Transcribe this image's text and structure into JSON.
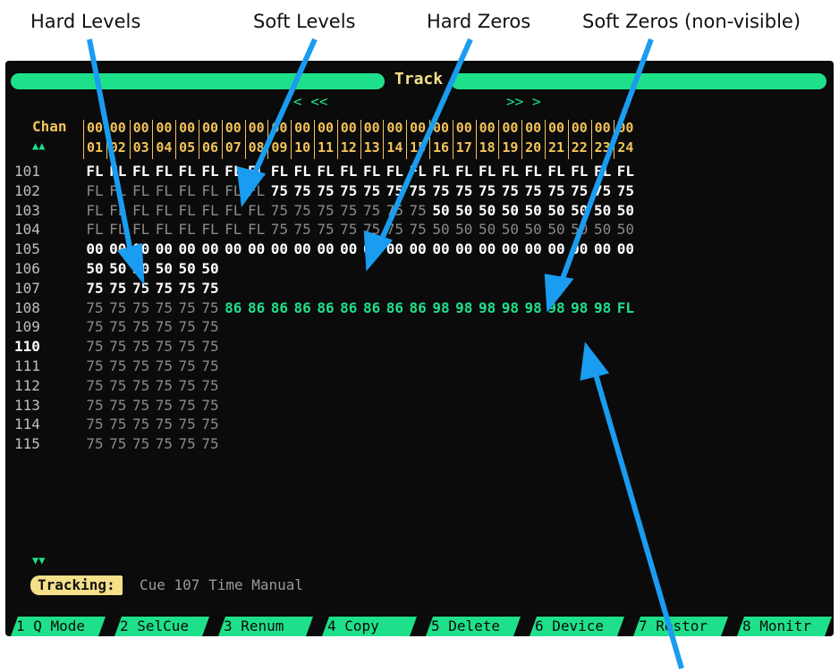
{
  "annotations": {
    "hard_levels": "Hard Levels",
    "soft_levels": "Soft Levels",
    "hard_zeros": "Hard Zeros",
    "soft_zeros": "Soft Zeros (non-visible)"
  },
  "screen": {
    "title": "Track",
    "nav_left": "< <<",
    "nav_right": ">> >",
    "chan_label": "Chan",
    "up_arrows": "▲▲",
    "down_arrows": "▼▼",
    "channel_hundreds": [
      "00",
      "00",
      "00",
      "00",
      "00",
      "00",
      "00",
      "00",
      "00",
      "00",
      "00",
      "00",
      "00",
      "00",
      "00",
      "00",
      "00",
      "00",
      "00",
      "00",
      "00",
      "00",
      "00",
      "00"
    ],
    "channel_units": [
      "01",
      "02",
      "03",
      "04",
      "05",
      "06",
      "07",
      "08",
      "09",
      "10",
      "11",
      "12",
      "13",
      "14",
      "15",
      "16",
      "17",
      "18",
      "19",
      "20",
      "21",
      "22",
      "23",
      "24"
    ],
    "cues": [
      {
        "num": "101",
        "cells": [
          "FL",
          "FL",
          "FL",
          "FL",
          "FL",
          "FL",
          "FL",
          "FL",
          "FL",
          "FL",
          "FL",
          "FL",
          "FL",
          "FL",
          "FL",
          "FL",
          "FL",
          "FL",
          "FL",
          "FL",
          "FL",
          "FL",
          "FL",
          "FL"
        ],
        "style": [
          "h",
          "h",
          "h",
          "h",
          "h",
          "h",
          "h",
          "h",
          "h",
          "h",
          "h",
          "h",
          "h",
          "h",
          "h",
          "h",
          "h",
          "h",
          "h",
          "h",
          "h",
          "h",
          "h",
          "h"
        ]
      },
      {
        "num": "102",
        "cells": [
          "FL",
          "FL",
          "FL",
          "FL",
          "FL",
          "FL",
          "FL",
          "FL",
          "75",
          "75",
          "75",
          "75",
          "75",
          "75",
          "75",
          "75",
          "75",
          "75",
          "75",
          "75",
          "75",
          "75",
          "75",
          "75"
        ],
        "style": [
          "s",
          "s",
          "s",
          "s",
          "s",
          "s",
          "s",
          "s",
          "h",
          "h",
          "h",
          "h",
          "h",
          "h",
          "h",
          "h",
          "h",
          "h",
          "h",
          "h",
          "h",
          "h",
          "h",
          "h"
        ]
      },
      {
        "num": "103",
        "cells": [
          "FL",
          "FL",
          "FL",
          "FL",
          "FL",
          "FL",
          "FL",
          "FL",
          "75",
          "75",
          "75",
          "75",
          "75",
          "75",
          "75",
          "50",
          "50",
          "50",
          "50",
          "50",
          "50",
          "50",
          "50",
          "50"
        ],
        "style": [
          "s",
          "s",
          "s",
          "s",
          "s",
          "s",
          "s",
          "s",
          "s",
          "s",
          "s",
          "s",
          "s",
          "s",
          "s",
          "h",
          "h",
          "h",
          "h",
          "h",
          "h",
          "h",
          "h",
          "h"
        ]
      },
      {
        "num": "104",
        "cells": [
          "FL",
          "FL",
          "FL",
          "FL",
          "FL",
          "FL",
          "FL",
          "FL",
          "75",
          "75",
          "75",
          "75",
          "75",
          "75",
          "75",
          "50",
          "50",
          "50",
          "50",
          "50",
          "50",
          "50",
          "50",
          "50"
        ],
        "style": [
          "s",
          "s",
          "s",
          "s",
          "s",
          "s",
          "s",
          "s",
          "s",
          "s",
          "s",
          "s",
          "s",
          "s",
          "s",
          "s",
          "s",
          "s",
          "s",
          "s",
          "s",
          "s",
          "s",
          "s"
        ]
      },
      {
        "num": "105",
        "cells": [
          "00",
          "00",
          "00",
          "00",
          "00",
          "00",
          "00",
          "00",
          "00",
          "00",
          "00",
          "00",
          "00",
          "00",
          "00",
          "00",
          "00",
          "00",
          "00",
          "00",
          "00",
          "00",
          "00",
          "00"
        ],
        "style": [
          "h",
          "h",
          "h",
          "h",
          "h",
          "h",
          "h",
          "h",
          "h",
          "h",
          "h",
          "h",
          "h",
          "h",
          "h",
          "h",
          "h",
          "h",
          "h",
          "h",
          "h",
          "h",
          "h",
          "h"
        ]
      },
      {
        "num": "106",
        "cells": [
          "50",
          "50",
          "50",
          "50",
          "50",
          "50"
        ],
        "style": [
          "h",
          "h",
          "h",
          "h",
          "h",
          "h"
        ]
      },
      {
        "num": "107",
        "cells": [
          "75",
          "75",
          "75",
          "75",
          "75",
          "75"
        ],
        "style": [
          "h",
          "h",
          "h",
          "h",
          "h",
          "h"
        ]
      },
      {
        "num": "108",
        "cells": [
          "75",
          "75",
          "75",
          "75",
          "75",
          "75",
          "86",
          "86",
          "86",
          "86",
          "86",
          "86",
          "86",
          "86",
          "86",
          "98",
          "98",
          "98",
          "98",
          "98",
          "98",
          "98",
          "98",
          "FL"
        ],
        "style": [
          "s",
          "s",
          "s",
          "s",
          "s",
          "s",
          "g",
          "g",
          "g",
          "g",
          "g",
          "g",
          "g",
          "g",
          "g",
          "g",
          "g",
          "g",
          "g",
          "g",
          "g",
          "g",
          "g",
          "g"
        ]
      },
      {
        "num": "109",
        "cells": [
          "75",
          "75",
          "75",
          "75",
          "75",
          "75"
        ],
        "style": [
          "s",
          "s",
          "s",
          "s",
          "s",
          "s"
        ]
      },
      {
        "num": "110",
        "cells": [
          "75",
          "75",
          "75",
          "75",
          "75",
          "75"
        ],
        "style": [
          "s",
          "s",
          "s",
          "s",
          "s",
          "s"
        ],
        "current": true
      },
      {
        "num": "111",
        "cells": [
          "75",
          "75",
          "75",
          "75",
          "75",
          "75"
        ],
        "style": [
          "s",
          "s",
          "s",
          "s",
          "s",
          "s"
        ]
      },
      {
        "num": "112",
        "cells": [
          "75",
          "75",
          "75",
          "75",
          "75",
          "75"
        ],
        "style": [
          "s",
          "s",
          "s",
          "s",
          "s",
          "s"
        ]
      },
      {
        "num": "113",
        "cells": [
          "75",
          "75",
          "75",
          "75",
          "75",
          "75"
        ],
        "style": [
          "s",
          "s",
          "s",
          "s",
          "s",
          "s"
        ]
      },
      {
        "num": "114",
        "cells": [
          "75",
          "75",
          "75",
          "75",
          "75",
          "75"
        ],
        "style": [
          "s",
          "s",
          "s",
          "s",
          "s",
          "s"
        ]
      },
      {
        "num": "115",
        "cells": [
          "75",
          "75",
          "75",
          "75",
          "75",
          "75"
        ],
        "style": [
          "s",
          "s",
          "s",
          "s",
          "s",
          "s"
        ]
      }
    ],
    "tracking_label": "Tracking:",
    "tracking_text": "Cue 107 Time Manual",
    "softkeys": [
      "1 Q Mode",
      "2 SelCue",
      "3 Renum",
      "4 Copy",
      "5 Delete",
      "6 Device",
      "7 Restor",
      "8 Monitr"
    ]
  },
  "colors": {
    "accent_green": "#1fe08a",
    "header_amber": "#f4c45a",
    "hard_value": "#ffffff",
    "soft_value": "#8a8a8a",
    "arrow_blue": "#1a9cf0"
  }
}
